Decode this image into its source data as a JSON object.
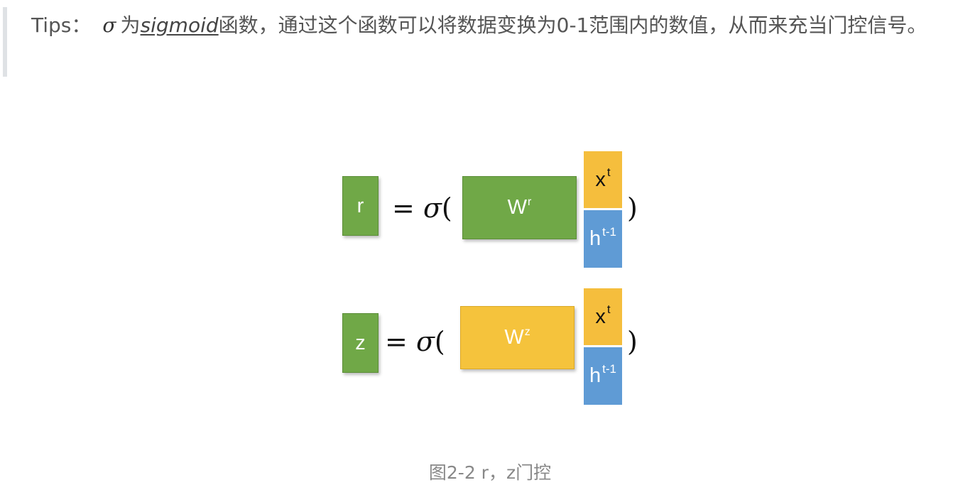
{
  "tip": {
    "prefix": "Tips：",
    "sigma_symbol": "σ",
    "text_before_link": "为",
    "link_text": "sigmoid",
    "text_after_link": "函数，通过这个函数可以将数据变换为0-1范围内的数值，从而来充当门控信号。"
  },
  "figure": {
    "row_r": {
      "output_label": "r",
      "equals": "=",
      "sigma": "σ",
      "open_paren": "(",
      "weight_base": "W",
      "weight_sup": "r",
      "x_base": "x",
      "x_sup": "t",
      "h_base": "h",
      "h_sup": "t-1",
      "close_paren": ")"
    },
    "row_z": {
      "output_label": "z",
      "equals": "=",
      "sigma": "σ",
      "open_paren": "(",
      "weight_base": "W",
      "weight_sup": "z",
      "x_base": "x",
      "x_sup": "t",
      "h_base": "h",
      "h_sup": "t-1",
      "close_paren": ")"
    },
    "colors": {
      "green": "#70a847",
      "yellow": "#f5c33c",
      "blue": "#5f9bd5"
    }
  },
  "caption": "图2-2 r，z门控"
}
